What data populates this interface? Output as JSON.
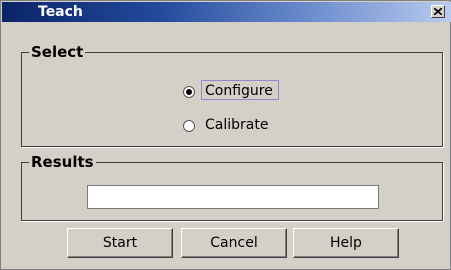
{
  "window": {
    "title": "Teach",
    "close_icon": "close-x-icon"
  },
  "select_group": {
    "legend": "Select",
    "options": [
      {
        "label": "Configure",
        "selected": true,
        "focused": true
      },
      {
        "label": "Calibrate",
        "selected": false,
        "focused": false
      }
    ]
  },
  "results_group": {
    "legend": "Results",
    "field_value": ""
  },
  "buttons": {
    "start": "Start",
    "cancel": "Cancel",
    "help": "Help"
  },
  "colors": {
    "title_gradient_start": "#0a2468",
    "title_gradient_end": "#b9cbee",
    "dialog_bg": "#d4d0c8"
  }
}
